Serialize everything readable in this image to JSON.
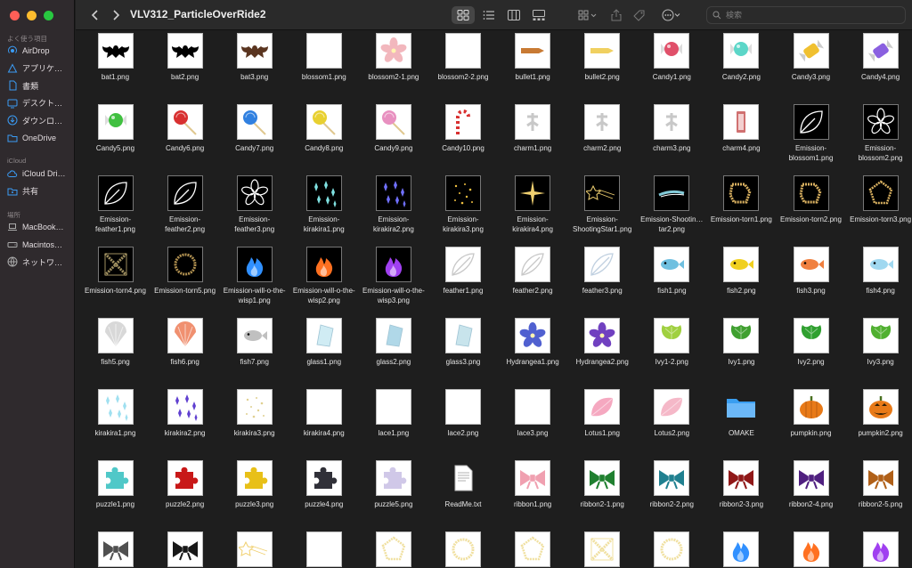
{
  "window": {
    "title": "VLV312_ParticleOverRide2"
  },
  "sidebar": {
    "favorites_label": "よく使う項目",
    "favorites": [
      {
        "label": "AirDrop",
        "icon": "airdrop-icon"
      },
      {
        "label": "アプリケ…",
        "icon": "applications-icon"
      },
      {
        "label": "書類",
        "icon": "document-icon"
      },
      {
        "label": "デスクト…",
        "icon": "desktop-icon"
      },
      {
        "label": "ダウンロ…",
        "icon": "download-icon"
      },
      {
        "label": "OneDrive",
        "icon": "folder-icon"
      }
    ],
    "icloud_label": "iCloud",
    "icloud": [
      {
        "label": "iCloud Dri…",
        "icon": "cloud-icon"
      },
      {
        "label": "共有",
        "icon": "shared-folder-icon"
      }
    ],
    "locations_label": "場所",
    "locations": [
      {
        "label": "MacBook…",
        "icon": "laptop-icon"
      },
      {
        "label": "Macintos…",
        "icon": "disk-icon"
      },
      {
        "label": "ネットワ…",
        "icon": "network-icon"
      }
    ]
  },
  "toolbar": {
    "search_placeholder": "検索",
    "views": [
      "icon-view-icon",
      "list-view-icon",
      "column-view-icon",
      "gallery-view-icon"
    ]
  },
  "files": [
    [
      {
        "name": "bat1.png",
        "kind": "bat",
        "color": "#000000"
      },
      {
        "name": "bat2.png",
        "kind": "bat",
        "color": "#000000"
      },
      {
        "name": "bat3.png",
        "kind": "bat",
        "color": "#5a3520"
      },
      {
        "name": "blossom1.png",
        "kind": "blank"
      },
      {
        "name": "blossom2-1.png",
        "kind": "flower",
        "color": "#f2b7bd"
      },
      {
        "name": "blossom2-2.png",
        "kind": "blank"
      },
      {
        "name": "bullet1.png",
        "kind": "bullet",
        "color": "#c87a33"
      },
      {
        "name": "bullet2.png",
        "kind": "bullet",
        "color": "#f0d060"
      },
      {
        "name": "Candy1.png",
        "kind": "candy",
        "color": "#e0506a"
      },
      {
        "name": "Candy2.png",
        "kind": "candy",
        "color": "#5cd6c8"
      },
      {
        "name": "Candy3.png",
        "kind": "wrapcandy",
        "color": "#f0c030"
      },
      {
        "name": "Candy4.png",
        "kind": "wrapcandy",
        "color": "#8a60e0"
      }
    ],
    [
      {
        "name": "Candy5.png",
        "kind": "candy",
        "color": "#40c040"
      },
      {
        "name": "Candy6.png",
        "kind": "lollipop",
        "color": "#d83030"
      },
      {
        "name": "Candy7.png",
        "kind": "lollipop",
        "color": "#3080e0"
      },
      {
        "name": "Candy8.png",
        "kind": "lollipop",
        "color": "#e8d030"
      },
      {
        "name": "Candy9.png",
        "kind": "lollipop",
        "color": "#e890c0"
      },
      {
        "name": "Candy10.png",
        "kind": "cane",
        "color": "#d83030"
      },
      {
        "name": "charm1.png",
        "kind": "charm",
        "color": "#c8c8c8"
      },
      {
        "name": "charm2.png",
        "kind": "charm",
        "color": "#c8c8c8"
      },
      {
        "name": "charm3.png",
        "kind": "charm",
        "color": "#c8c8c8"
      },
      {
        "name": "charm4.png",
        "kind": "tag",
        "color": "#d07070"
      },
      {
        "name": "Emission-blossom1.png",
        "kind": "outline-leaf",
        "dark": true,
        "color": "#ffffff"
      },
      {
        "name": "Emission-blossom2.png",
        "kind": "outline-flower",
        "dark": true,
        "color": "#ffffff"
      }
    ],
    [
      {
        "name": "Emission-feather1.png",
        "kind": "outline-leaf",
        "dark": true,
        "color": "#ffffff"
      },
      {
        "name": "Emission-feather2.png",
        "kind": "outline-leaf",
        "dark": true,
        "color": "#ffffff"
      },
      {
        "name": "Emission-feather3.png",
        "kind": "outline-flower",
        "dark": true,
        "color": "#ffffff"
      },
      {
        "name": "Emission-kirakira1.png",
        "kind": "diamonds",
        "dark": true,
        "color": "#7fe0e0"
      },
      {
        "name": "Emission-kirakira2.png",
        "kind": "diamonds",
        "dark": true,
        "color": "#7070ff"
      },
      {
        "name": "Emission-kirakira3.png",
        "kind": "dots",
        "dark": true,
        "color": "#f0c040"
      },
      {
        "name": "Emission-kirakira4.png",
        "kind": "star4",
        "dark": true,
        "color": "#f0d070"
      },
      {
        "name": "Emission-ShootingStar1.png",
        "kind": "shootingstar",
        "dark": true,
        "color": "#f0d070"
      },
      {
        "name": "Emission-Shootin…tar2.png",
        "kind": "streak",
        "dark": true,
        "color": "#90e0f0"
      },
      {
        "name": "Emission-torn1.png",
        "kind": "torn",
        "dark": true,
        "color": "#d8b060"
      },
      {
        "name": "Emission-torn2.png",
        "kind": "torn",
        "dark": true,
        "color": "#d8b060"
      },
      {
        "name": "Emission-torn3.png",
        "kind": "pentagon",
        "dark": true,
        "color": "#d8b060"
      }
    ],
    [
      {
        "name": "Emission-torn4.png",
        "kind": "cross",
        "dark": true,
        "color": "#a09060"
      },
      {
        "name": "Emission-torn5.png",
        "kind": "ring",
        "dark": true,
        "color": "#b09050"
      },
      {
        "name": "Emission-will-o-the-wisp1.png",
        "kind": "flame",
        "dark": true,
        "color": "#3090ff"
      },
      {
        "name": "Emission-will-o-the-wisp2.png",
        "kind": "flame",
        "dark": true,
        "color": "#ff7020"
      },
      {
        "name": "Emission-will-o-the-wisp3.png",
        "kind": "flame",
        "dark": true,
        "color": "#a040f0"
      },
      {
        "name": "feather1.png",
        "kind": "feather",
        "color": "#c8c8c8"
      },
      {
        "name": "feather2.png",
        "kind": "feather",
        "color": "#c8c8c8"
      },
      {
        "name": "feather3.png",
        "kind": "feather",
        "color": "#c0d0e0"
      },
      {
        "name": "fish1.png",
        "kind": "fish",
        "color": "#70c0e0"
      },
      {
        "name": "fish2.png",
        "kind": "fish",
        "color": "#f0d020"
      },
      {
        "name": "fish3.png",
        "kind": "fish",
        "color": "#f08040"
      },
      {
        "name": "fish4.png",
        "kind": "fish",
        "color": "#a0d8f0"
      }
    ],
    [
      {
        "name": "fish5.png",
        "kind": "shell",
        "color": "#d8d8d8"
      },
      {
        "name": "fish6.png",
        "kind": "shell",
        "color": "#f09070"
      },
      {
        "name": "fish7.png",
        "kind": "fish",
        "color": "#c0c0c0"
      },
      {
        "name": "glass1.png",
        "kind": "glass",
        "color": "#d0ecf4"
      },
      {
        "name": "glass2.png",
        "kind": "glass",
        "color": "#b0d8e8"
      },
      {
        "name": "glass3.png",
        "kind": "glass",
        "color": "#c8e4ec"
      },
      {
        "name": "Hydrangea1.png",
        "kind": "flower",
        "color": "#5060d0"
      },
      {
        "name": "Hydrangea2.png",
        "kind": "flower",
        "color": "#7040c0"
      },
      {
        "name": "Ivy1-2.png",
        "kind": "ivy",
        "color": "#a0d040"
      },
      {
        "name": "Ivy1.png",
        "kind": "ivy",
        "color": "#40a030"
      },
      {
        "name": "Ivy2.png",
        "kind": "ivy",
        "color": "#30a030"
      },
      {
        "name": "Ivy3.png",
        "kind": "ivy",
        "color": "#50b030"
      }
    ],
    [
      {
        "name": "kirakira1.png",
        "kind": "diamonds",
        "color": "#a0e0f0"
      },
      {
        "name": "kirakira2.png",
        "kind": "diamonds",
        "color": "#6040d0"
      },
      {
        "name": "kirakira3.png",
        "kind": "dots",
        "color": "#e0d090"
      },
      {
        "name": "kirakira4.png",
        "kind": "blank"
      },
      {
        "name": "lace1.png",
        "kind": "blank"
      },
      {
        "name": "lace2.png",
        "kind": "blank"
      },
      {
        "name": "lace3.png",
        "kind": "blank"
      },
      {
        "name": "Lotus1.png",
        "kind": "petal",
        "color": "#f5a8c0"
      },
      {
        "name": "Lotus2.png",
        "kind": "petal",
        "color": "#f5b8c8"
      },
      {
        "name": "OMAKE",
        "kind": "folder",
        "color": "#3a9ef0"
      },
      {
        "name": "pumpkin.png",
        "kind": "pumpkin",
        "color": "#e87a18"
      },
      {
        "name": "pumpkin2.png",
        "kind": "jack",
        "color": "#e87a18"
      }
    ],
    [
      {
        "name": "puzzle1.png",
        "kind": "puzzle",
        "color": "#50c8c8"
      },
      {
        "name": "puzzle2.png",
        "kind": "puzzle",
        "color": "#c81818"
      },
      {
        "name": "puzzle3.png",
        "kind": "puzzle",
        "color": "#e8c018"
      },
      {
        "name": "puzzle4.png",
        "kind": "puzzle",
        "color": "#303038"
      },
      {
        "name": "puzzle5.png",
        "kind": "puzzle",
        "color": "#d0c8e8"
      },
      {
        "name": "ReadMe.txt",
        "kind": "txt",
        "color": "#ffffff"
      },
      {
        "name": "ribbon1.png",
        "kind": "ribbon",
        "color": "#f0a0b0"
      },
      {
        "name": "ribbon2-1.png",
        "kind": "ribbon",
        "color": "#208030"
      },
      {
        "name": "ribbon2-2.png",
        "kind": "ribbon",
        "color": "#208090"
      },
      {
        "name": "ribbon2-3.png",
        "kind": "ribbon",
        "color": "#901818"
      },
      {
        "name": "ribbon2-4.png",
        "kind": "ribbon",
        "color": "#502080"
      },
      {
        "name": "ribbon2-5.png",
        "kind": "ribbon",
        "color": "#b06018"
      }
    ],
    [
      {
        "name": "",
        "kind": "ribbon",
        "color": "#505050"
      },
      {
        "name": "",
        "kind": "ribbon",
        "color": "#181818"
      },
      {
        "name": "",
        "kind": "shootingstar",
        "color": "#f0d070"
      },
      {
        "name": "",
        "kind": "blank"
      },
      {
        "name": "",
        "kind": "pentagon",
        "color": "#f0e0a0"
      },
      {
        "name": "",
        "kind": "ring",
        "color": "#f0e0a0"
      },
      {
        "name": "",
        "kind": "pentagon",
        "color": "#f0e0a0"
      },
      {
        "name": "",
        "kind": "cross",
        "color": "#f0e0a0"
      },
      {
        "name": "",
        "kind": "ring",
        "color": "#f0e0a0"
      },
      {
        "name": "",
        "kind": "flame",
        "color": "#3090ff"
      },
      {
        "name": "",
        "kind": "flame",
        "color": "#ff7020"
      },
      {
        "name": "",
        "kind": "flame",
        "color": "#a040f0"
      }
    ]
  ]
}
